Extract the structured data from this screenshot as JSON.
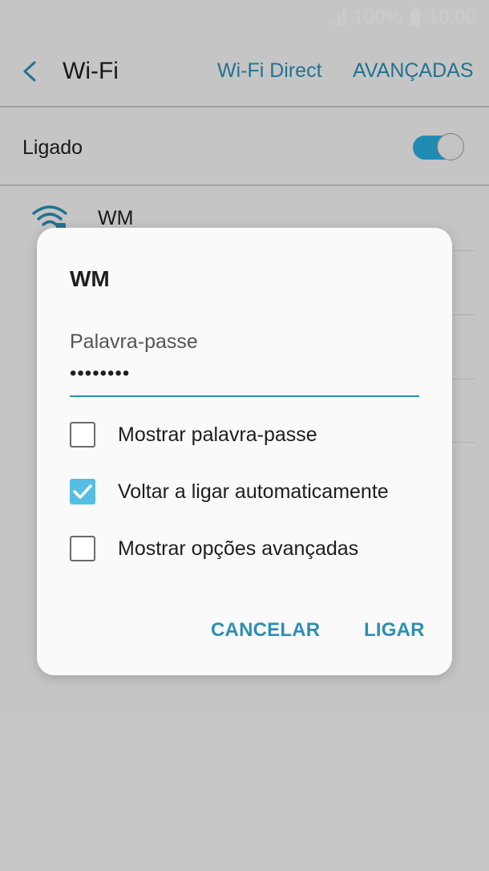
{
  "status_bar": {
    "battery": "100%",
    "time": "10:00"
  },
  "app_bar": {
    "title": "Wi-Fi",
    "actions": [
      "Wi-Fi Direct",
      "AVANÇADAS"
    ]
  },
  "wifi_toggle": {
    "label": "Ligado",
    "on": true
  },
  "networks": [
    {
      "name": "WM",
      "icon": "wifi-secured-icon"
    }
  ],
  "dialog": {
    "title": "WM",
    "password_label": "Palavra-passe",
    "password_value": "••••••••",
    "options": [
      {
        "label": "Mostrar palavra-passe",
        "checked": false
      },
      {
        "label": "Voltar a ligar automaticamente",
        "checked": true
      },
      {
        "label": "Mostrar opções avançadas",
        "checked": false
      }
    ],
    "buttons": {
      "cancel": "CANCELAR",
      "connect": "LIGAR"
    }
  },
  "colors": {
    "accent": "#2d8fb4",
    "switch_on": "#2ab0e0",
    "checkbox_checked": "#55bfe3"
  }
}
